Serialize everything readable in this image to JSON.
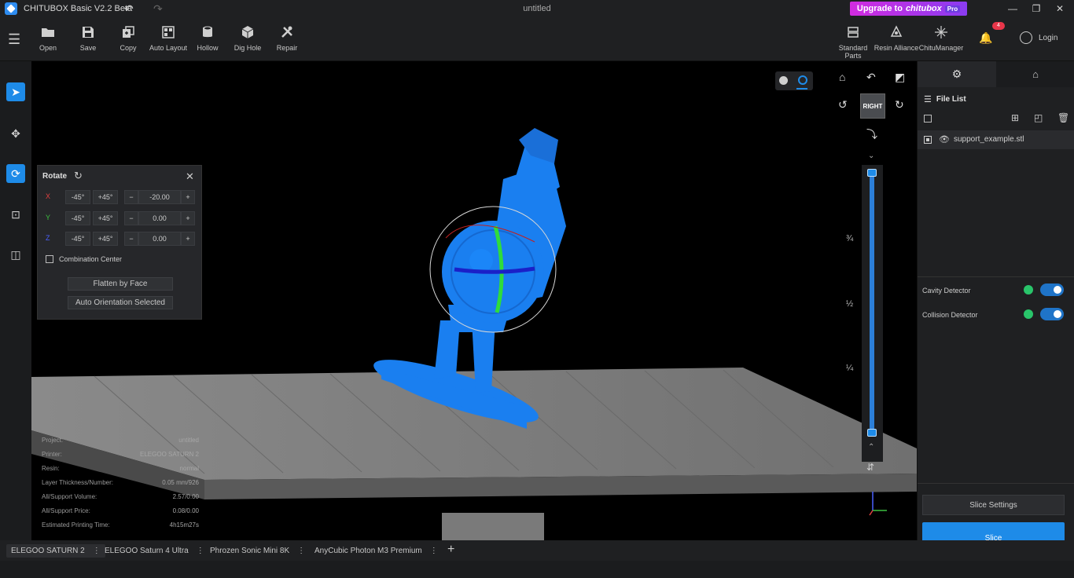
{
  "titlebar": {
    "app_title": "CHITUBOX Basic V2.2 Beta",
    "doc_title": "untitled",
    "upgrade_prefix": "Upgrade to",
    "upgrade_brand": "chitubox",
    "upgrade_badge": "Pro"
  },
  "toolbar": {
    "tools": [
      {
        "label": "Open",
        "icon": "folder-icon"
      },
      {
        "label": "Save",
        "icon": "save-icon"
      },
      {
        "label": "Copy",
        "icon": "copy-icon"
      },
      {
        "label": "Auto Layout",
        "icon": "auto-layout-icon"
      },
      {
        "label": "Hollow",
        "icon": "hollow-icon"
      },
      {
        "label": "Dig Hole",
        "icon": "dig-hole-icon"
      },
      {
        "label": "Repair",
        "icon": "repair-icon"
      }
    ],
    "right_tools": [
      {
        "label": "Standard Parts",
        "icon": "standard-parts-icon"
      },
      {
        "label": "Resin Alliance",
        "icon": "resin-alliance-icon"
      },
      {
        "label": "ChituManager",
        "icon": "chitumanager-icon"
      }
    ],
    "notification_count": "4",
    "login_label": "Login"
  },
  "rotate_panel": {
    "title": "Rotate",
    "rows": [
      {
        "axis": "X",
        "minus_label": "-45°",
        "plus_label": "+45°",
        "value": "-20.00",
        "color": "#e04040"
      },
      {
        "axis": "Y",
        "minus_label": "-45°",
        "plus_label": "+45°",
        "value": "0.00",
        "color": "#3cc040"
      },
      {
        "axis": "Z",
        "minus_label": "-45°",
        "plus_label": "+45°",
        "value": "0.00",
        "color": "#4a60ff"
      }
    ],
    "combination_center_label": "Combination Center",
    "flatten_label": "Flatten by Face",
    "auto_orient_label": "Auto Orientation Selected"
  },
  "view_cube": {
    "face_label": "RIGHT"
  },
  "layer_slider": {
    "marks": [
      "¾",
      "½",
      "¼"
    ],
    "fill_fraction": 1.0
  },
  "info": {
    "rows": [
      {
        "label": "Project:",
        "value": "untitled"
      },
      {
        "label": "Printer:",
        "value": "ELEGOO SATURN 2"
      },
      {
        "label": "Resin:",
        "value": "normal"
      },
      {
        "label": "Layer Thickness/Number:",
        "value": "0.05 mm/926"
      },
      {
        "label": "All/Support Volume:",
        "value": "2.57/0.00"
      },
      {
        "label": "All/Support Price:",
        "value": "0.08/0.00"
      },
      {
        "label": "Estimated Printing Time:",
        "value": "4h15m27s"
      }
    ]
  },
  "right_panel": {
    "file_list_title": "File List",
    "files": [
      {
        "name": "support_example.stl"
      }
    ],
    "cavity_detector_label": "Cavity Detector",
    "collision_detector_label": "Collision Detector",
    "slice_settings_label": "Slice Settings",
    "slice_label": "Slice"
  },
  "printer_tabs": [
    {
      "label": "ELEGOO SATURN 2",
      "active": true
    },
    {
      "label": "ELEGOO Saturn 4 Ultra",
      "active": false
    },
    {
      "label": "Phrozen Sonic Mini 8K",
      "active": false
    },
    {
      "label": "AnyCubic Photon M3 Premium",
      "active": false
    }
  ],
  "colors": {
    "accent": "#1e8be8",
    "model": "#1a7ff0",
    "upgrade_gradient_start": "#d22be0",
    "upgrade_gradient_end": "#8a3cf0"
  }
}
